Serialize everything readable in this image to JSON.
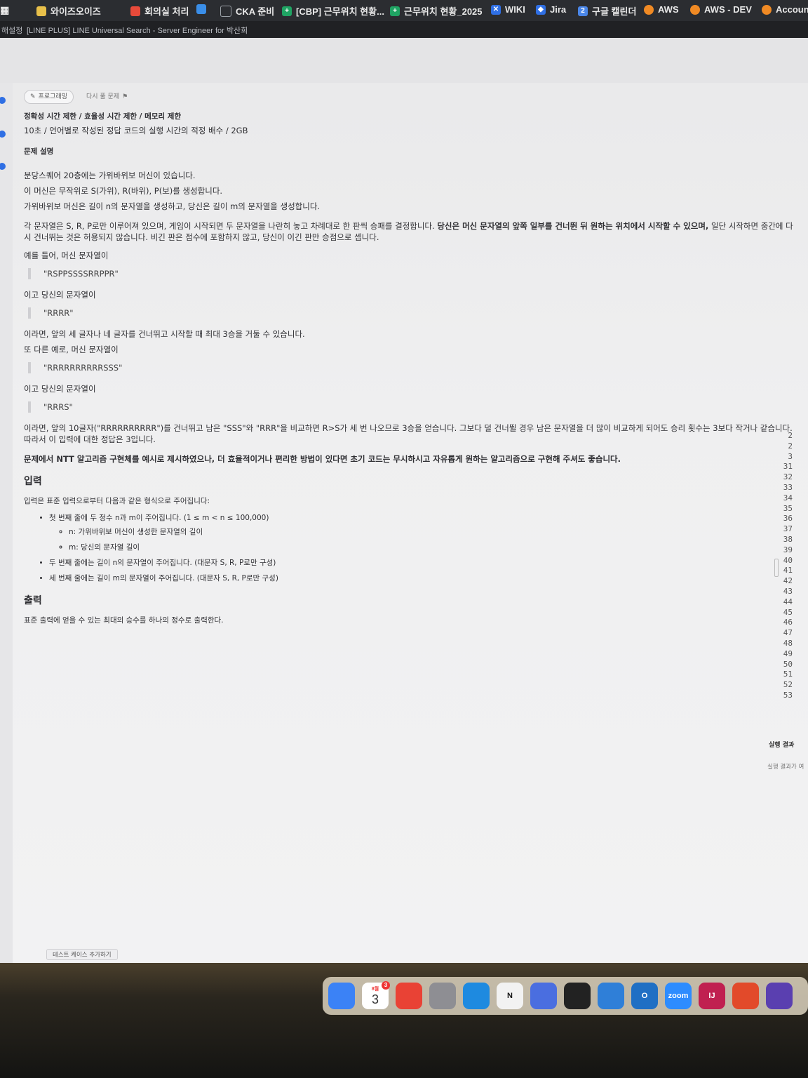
{
  "bookmarks": [
    {
      "label": "와이즈오이즈",
      "icon": "square-icon",
      "color": "#e8c04a"
    },
    {
      "label": "회의실 처리",
      "icon": "google-icon",
      "color": "#e84a3a"
    },
    {
      "label": "",
      "icon": "google-drive-icon",
      "color": "#3a8ee8"
    },
    {
      "label": "CKA 준비",
      "icon": "folder-icon",
      "color": "#9aa0a6"
    },
    {
      "label": "[CBP] 근무위치 현황...",
      "icon": "sheets-icon",
      "color": "#1fa463"
    },
    {
      "label": "근무위치 현황_2025",
      "icon": "sheets-icon",
      "color": "#1fa463"
    },
    {
      "label": "WIKI",
      "icon": "confluence-icon",
      "color": "#2f6fe4"
    },
    {
      "label": "Jira",
      "icon": "jira-icon",
      "color": "#2f6fe4"
    },
    {
      "label": "구글 캘린더",
      "icon": "calendar-icon",
      "color": "#4a86e8"
    },
    {
      "label": "AWS",
      "icon": "aws-icon",
      "color": "#f08a24"
    },
    {
      "label": "AWS - DEV",
      "icon": "aws-icon",
      "color": "#f08a24"
    },
    {
      "label": "Accoun",
      "icon": "aws-icon",
      "color": "#f08a24"
    }
  ],
  "titlebar": {
    "left_text": "해설정",
    "title": "[LINE PLUS] LINE Universal Search - Server Engineer for 박산희"
  },
  "problem": {
    "chip_programming": "프로그래밍",
    "chip_retry": "다시 풀 문제",
    "limits_heading": "정확성 시간 제한 / 효율성 시간 제한 / 메모리 제한",
    "limits_value": "10초 / 언어별로 작성된 정답 코드의 실행 시간의 적정 배수 / 2GB",
    "desc_heading": "문제 설명",
    "desc1": "분당스퀘어 20층에는 가위바위보 머신이 있습니다.",
    "desc2": "이 머신은 무작위로 S(가위), R(바위), P(보)를 생성합니다.",
    "desc3": "가위바위보 머신은 길이 n의 문자열을 생성하고, 당신은 길이 m의 문자열을 생성합니다.",
    "desc4a": "각 문자열은 S, R, P로만 이루어져 있으며, 게임이 시작되면 두 문자열을 나란히 놓고 차례대로 한 판씩 승패를 결정합니다. ",
    "desc4b": "당신은 머신 문자열의 앞쪽 일부를 건너뛴 뒤 원하는 위치에서 시작할 수 있으며,",
    "desc4c": " 일단 시작하면 중간에 다시 건너뛰는 것은 허용되지 않습니다. 비긴 판은 점수에 포함하지 않고, 당신이 이긴 판만 승점으로 셉니다.",
    "ex1_intro": "예를 들어, 머신 문자열이",
    "ex1_machine": "\"RSPPSSSSRRPPR\"",
    "ex1_mine_intro": "이고 당신의 문자열이",
    "ex1_mine": "\"RRRR\"",
    "ex1_result": "이라면, 앞의 세 글자나 네 글자를 건너뛰고 시작할 때 최대 3승을 거둘 수 있습니다.",
    "ex2_intro": "또 다른 예로, 머신 문자열이",
    "ex2_machine": "\"RRRRRRRRRRSSS\"",
    "ex2_mine_intro": "이고 당신의 문자열이",
    "ex2_mine": "\"RRRS\"",
    "ex2_result": "이라면, 앞의 10글자(\"RRRRRRRRRR\")를 건너뛰고 남은 \"SSS\"와 \"RRR\"을 비교하면 R>S가 세 번 나오므로 3승을 얻습니다. 그보다 덜 건너뛸 경우 남은 문자열을 더 많이 비교하게 되어도 승리 횟수는 3보다 작거나 같습니다. 따라서 이 입력에 대한 정답은 3입니다.",
    "note": "문제에서 NTT 알고리즘 구현체를 예시로 제시하였으나, 더 효율적이거나 편리한 방법이 있다면 초기 코드는 무시하시고 자유롭게 원하는 알고리즘으로 구현해 주셔도 좋습니다.",
    "input_heading": "입력",
    "input_intro": "입력은 표준 입력으로부터 다음과 같은 형식으로 주어집니다:",
    "input_line1": "첫 번째 줄에 두 정수 n과 m이 주어집니다. (1 ≤ m < n ≤ 100,000)",
    "input_line1_n": "n: 가위바위보 머신이 생성한 문자열의 길이",
    "input_line1_m": "m: 당신의 문자열 길이",
    "input_line2": "두 번째 줄에는 길이 n의 문자열이 주어집니다. (대문자 S, R, P로만 구성)",
    "input_line3": "세 번째 줄에는 길이 m의 문자열이 주어집니다. (대문자 S, R, P로만 구성)",
    "output_heading": "출력",
    "output_text": "표준 출력에 얻을 수 있는 최대의 승수를 하나의 정수로 출력한다."
  },
  "editor": {
    "line_numbers": [
      "2",
      "2",
      "3",
      "31",
      "32",
      "33",
      "34",
      "35",
      "36",
      "37",
      "38",
      "39",
      "40",
      "41",
      "42",
      "43",
      "44",
      "45",
      "46",
      "47",
      "48",
      "49",
      "50",
      "51",
      "52",
      "53"
    ],
    "run_result_title": "실행 결과",
    "run_result_text": "실행 결과가 여"
  },
  "add_test_case": "테스트 케이스 추가하기",
  "dock": {
    "calendar_month": "8월",
    "calendar_day": "3",
    "calendar_badge": "3",
    "apps": [
      {
        "name": "finder-icon",
        "color": "#3b82f6",
        "label": ""
      },
      {
        "name": "calendar-icon",
        "color": "#ffffff",
        "label": ""
      },
      {
        "name": "chrome-icon",
        "color": "#e94235",
        "label": ""
      },
      {
        "name": "launchpad-icon",
        "color": "#8e8e93",
        "label": ""
      },
      {
        "name": "edge-icon",
        "color": "#1e8ae0",
        "label": ""
      },
      {
        "name": "notion-icon",
        "color": "#f2f2f2",
        "label": "N"
      },
      {
        "name": "screen-icon",
        "color": "#4a6ee0",
        "label": ""
      },
      {
        "name": "cursor-icon",
        "color": "#222222",
        "label": ""
      },
      {
        "name": "vscode-icon",
        "color": "#2f7fd8",
        "label": ""
      },
      {
        "name": "outlook-icon",
        "color": "#1f6fc4",
        "label": "O"
      },
      {
        "name": "zoom-icon",
        "color": "#2d8cff",
        "label": "zoom"
      },
      {
        "name": "intellij-icon",
        "color": "#c02050",
        "label": "IJ"
      },
      {
        "name": "app-red-icon",
        "color": "#e24a2a",
        "label": ""
      },
      {
        "name": "app-purple-icon",
        "color": "#5a3fb0",
        "label": ""
      }
    ]
  }
}
